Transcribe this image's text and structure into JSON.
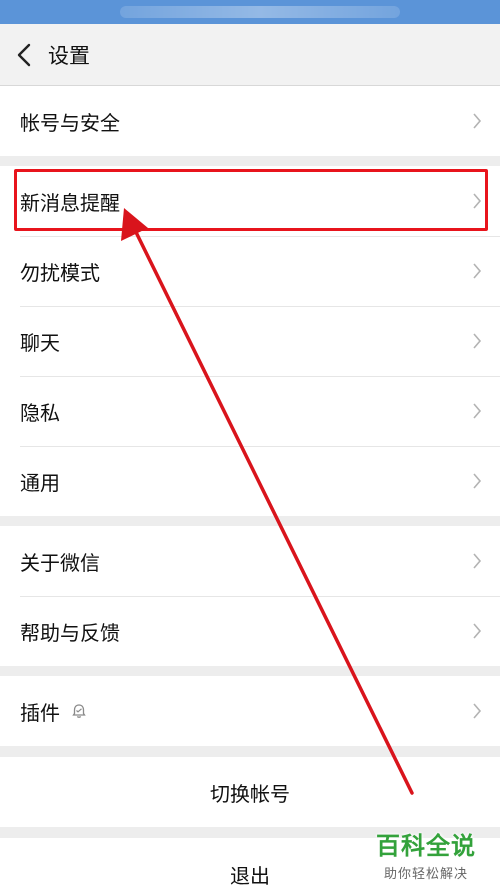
{
  "nav": {
    "title": "设置"
  },
  "groups": [
    {
      "items": [
        {
          "label": "帐号与安全"
        }
      ]
    },
    {
      "items": [
        {
          "label": "新消息提醒"
        },
        {
          "label": "勿扰模式"
        },
        {
          "label": "聊天"
        },
        {
          "label": "隐私"
        },
        {
          "label": "通用"
        }
      ]
    },
    {
      "items": [
        {
          "label": "关于微信"
        },
        {
          "label": "帮助与反馈"
        }
      ]
    },
    {
      "items": [
        {
          "label": "插件"
        }
      ]
    },
    {
      "items": [
        {
          "label": "切换帐号"
        }
      ]
    },
    {
      "items": [
        {
          "label": "退出"
        }
      ]
    }
  ],
  "annotation": {
    "highlight_color": "#e8141c"
  },
  "watermark": {
    "main": "百科全说",
    "sub": "助你轻松解决",
    "color": "#33a23b"
  },
  "colors": {
    "status_bar": "#5b94d8",
    "background": "#ededed",
    "row": "#ffffff"
  }
}
